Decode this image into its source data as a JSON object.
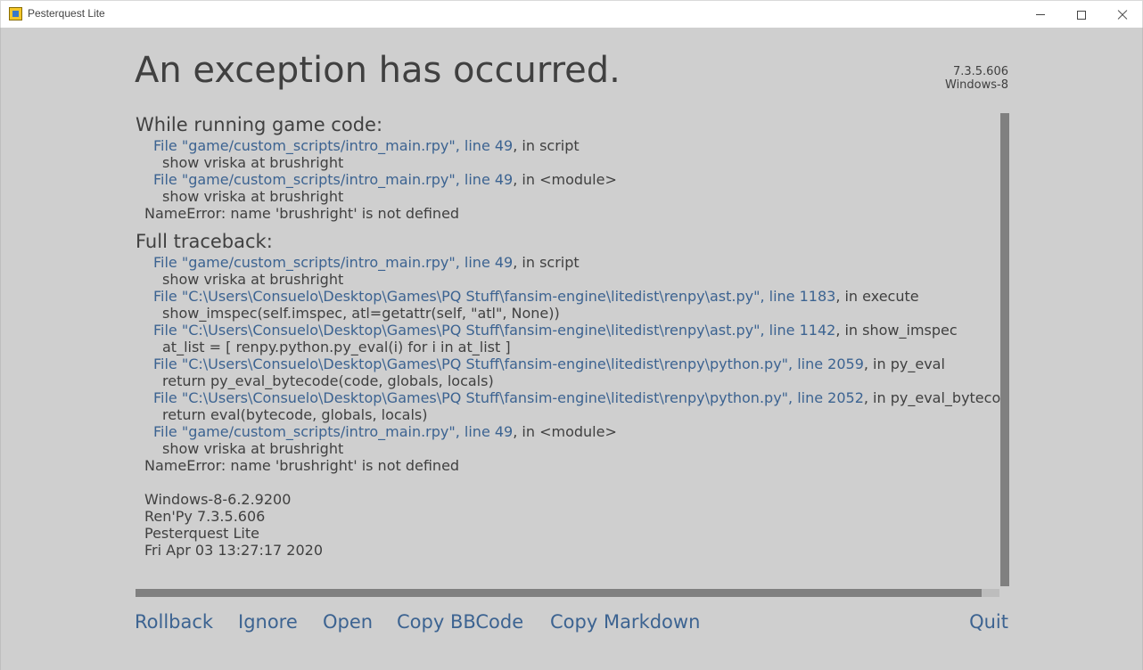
{
  "window": {
    "title": "Pesterquest Lite",
    "icon": "app-icon"
  },
  "header": {
    "title": "An exception has occurred.",
    "version": "7.3.5.606",
    "platform": "Windows-8"
  },
  "short_traceback": {
    "title": "While running game code:",
    "frames": [
      {
        "file": "File \"game/custom_scripts/intro_main.rpy\", line 49",
        "suffix": ", in script",
        "code": "show vriska at brushright"
      },
      {
        "file": "File \"game/custom_scripts/intro_main.rpy\", line 49",
        "suffix": ", in <module>",
        "code": "show vriska at brushright"
      }
    ],
    "error": "NameError: name 'brushright' is not defined"
  },
  "full_traceback": {
    "title": "Full traceback:",
    "frames": [
      {
        "file": "File \"game/custom_scripts/intro_main.rpy\", line 49",
        "suffix": ", in script",
        "code": "show vriska at brushright"
      },
      {
        "file": "File \"C:\\Users\\Consuelo\\Desktop\\Games\\PQ Stuff\\fansim-engine\\litedist\\renpy\\ast.py\", line 1183",
        "suffix": ", in execute",
        "code": "show_imspec(self.imspec, atl=getattr(self, \"atl\", None))"
      },
      {
        "file": "File \"C:\\Users\\Consuelo\\Desktop\\Games\\PQ Stuff\\fansim-engine\\litedist\\renpy\\ast.py\", line 1142",
        "suffix": ", in show_imspec",
        "code": "at_list = [ renpy.python.py_eval(i) for i in at_list ]"
      },
      {
        "file": "File \"C:\\Users\\Consuelo\\Desktop\\Games\\PQ Stuff\\fansim-engine\\litedist\\renpy\\python.py\", line 2059",
        "suffix": ", in py_eval",
        "code": "return py_eval_bytecode(code, globals, locals)"
      },
      {
        "file": "File \"C:\\Users\\Consuelo\\Desktop\\Games\\PQ Stuff\\fansim-engine\\litedist\\renpy\\python.py\", line 2052",
        "suffix": ", in py_eval_bytecode",
        "code": "return eval(bytecode, globals, locals)"
      },
      {
        "file": "File \"game/custom_scripts/intro_main.rpy\", line 49",
        "suffix": ", in <module>",
        "code": "show vriska at brushright"
      }
    ],
    "error": "NameError: name 'brushright' is not defined"
  },
  "system_info": [
    "Windows-8-6.2.9200",
    "Ren'Py 7.3.5.606",
    "Pesterquest Lite",
    "Fri Apr 03 13:27:17 2020"
  ],
  "buttons": {
    "rollback": "Rollback",
    "ignore": "Ignore",
    "open": "Open",
    "copy_bbcode": "Copy BBCode",
    "copy_markdown": "Copy Markdown",
    "quit": "Quit"
  },
  "colors": {
    "background": "#cfcfcf",
    "text": "#404040",
    "link": "#3c6391",
    "scrollbar_thumb": "#808080"
  }
}
